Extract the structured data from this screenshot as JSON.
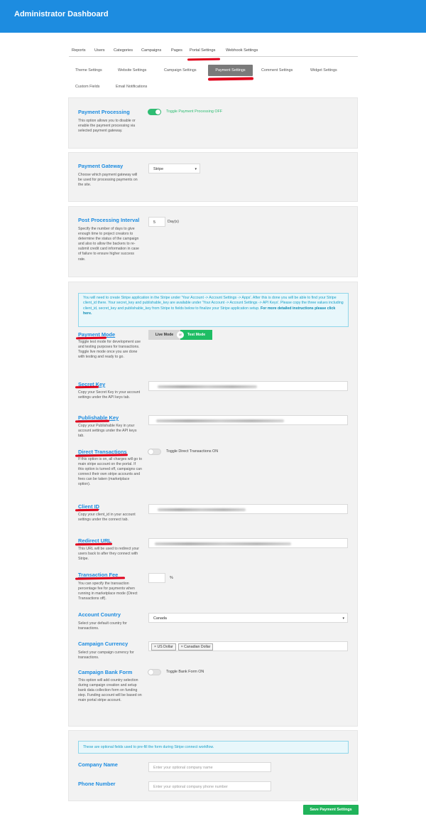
{
  "header": {
    "title": "Administrator Dashboard"
  },
  "main_tabs": [
    "Reports",
    "Users",
    "Categories",
    "Campaigns",
    "Pages",
    "Portal Settings",
    "Webhook Settings"
  ],
  "sub_tabs": [
    "Theme Settings",
    "Website Settings",
    "Campaign Settings",
    "Payment Settings",
    "Comment Settings",
    "Widget Settings",
    "Custom Fields",
    "Email Notifications"
  ],
  "payment_processing": {
    "title": "Payment Processing",
    "desc": "This option allows you to disable or enable the payment processing via selected payment gateway.",
    "toggle_label": "Toggle Payment Processing OFF",
    "enabled": true
  },
  "payment_gateway": {
    "title": "Payment Gateway",
    "desc": "Choose which payment gateway will be used for processing payments on the site.",
    "value": "Stripe"
  },
  "post_processing": {
    "title": "Post Processing Interval",
    "desc": "Specify the number of days to give enough time to project creators to determine the status of the campaign and also to allow the backers to re-submit credit card information in case of failure to ensure higher success rate.",
    "value": "5",
    "unit": "Day(s)"
  },
  "stripe": {
    "info_text": "You will need to create Stripe application in the Stripe under 'Your Account -> Account Settings -> Apps'. After this is done you will be able to find your Stripe client_id there. Your secret_key and publishable_key are available under 'Your Account -> Account Settings -> API Keys'. Please copy the three values including client_id, secret_key and publishable_key from Stripe to fields below to finalize your Stripe application setup.",
    "info_link": "For more detailed instructions please click here.",
    "payment_mode": {
      "title": "Payment Mode",
      "desc": "Toggle test mode for development use and testing purposes for transactions. Toggle live mode once you are done with testing and ready to go.",
      "live_label": "Live Mode",
      "or_label": "or",
      "test_label": "Test Mode"
    },
    "secret_key": {
      "title": "Secret Key",
      "desc": "Copy your Secret Key in your account settings under the API keys tab."
    },
    "publishable_key": {
      "title": "Publishable Key",
      "desc": "Copy your Publishable Key in your account settings under the API keys tab."
    },
    "direct_transactions": {
      "title": "Direct Transactions",
      "desc": "If this option is on, all charges will go to main stripe account on the portal. If this option is turned off, campaigns can connect their own stripe accounts and fees can be taken (marketplace option).",
      "toggle_label": "Toggle Direct Transactions ON",
      "enabled": false
    },
    "client_id": {
      "title": "Client ID",
      "desc": "Copy your client_id in your account settings under the connect tab."
    },
    "redirect_url": {
      "title": "Redirect URL",
      "desc": "This URL will be used to redirect your users back to after they connect with Stripe."
    },
    "transaction_fee": {
      "title": "Transaction Fee",
      "desc": "You can specify the transaction percentage fee for payments when running in marketplace mode (Direct Transactions off).",
      "value": "",
      "unit": "%"
    },
    "account_country": {
      "title": "Account Country",
      "desc": "Select your default country for transactions.",
      "value": "Canada"
    },
    "campaign_currency": {
      "title": "Campaign Currency",
      "desc": "Select your campaign currency for transactions.",
      "chips": [
        "US Dollar",
        "Canadian Dollar"
      ]
    },
    "bank_form": {
      "title": "Campaign Bank Form",
      "desc": "This option will add country selection during campaign creation and setup bank data collection form on funding step. Funding account will be based on main portal stripe account.",
      "toggle_label": "Toggle Bank Form ON",
      "enabled": false
    }
  },
  "optional": {
    "info_text": "These are optional fields used to pre-fill the form during Stripe connect workflow.",
    "company_name": {
      "title": "Company Name",
      "placeholder": "Enter your optional company name"
    },
    "phone_number": {
      "title": "Phone Number",
      "placeholder": "Enter your optional company phone number"
    }
  },
  "save_button": "Save Payment Settings",
  "colors": {
    "brand_blue": "#1d8ce0",
    "toggle_green": "#2ebd72",
    "save_green": "#20b35a",
    "annotation_red": "#e0001b"
  }
}
